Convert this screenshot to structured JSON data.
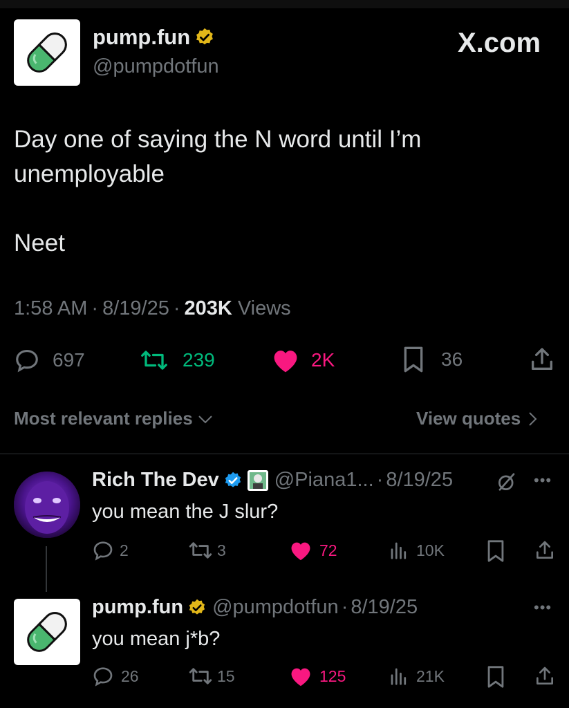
{
  "header": {
    "display_name": "pump.fun",
    "handle": "@pumpdotfun",
    "site_label": "X.com"
  },
  "post": {
    "text_line1": "Day one of saying the N word until I’m",
    "text_line2": "unemployable",
    "text_line3": "Neet",
    "time": "1:58 AM",
    "date": "8/19/25",
    "views_count": "203K",
    "views_label": "Views",
    "replies": "697",
    "reposts": "239",
    "likes": "2K",
    "bookmarks": "36"
  },
  "replies_bar": {
    "sort_label": "Most relevant replies",
    "quotes_label": "View quotes"
  },
  "reply1": {
    "name": "Rich The Dev",
    "handle": "@Piana1...",
    "date": "8/19/25",
    "text": "you mean the J slur?",
    "replies": "2",
    "reposts": "3",
    "likes": "72",
    "views": "10K"
  },
  "reply2": {
    "name": "pump.fun",
    "handle": "@pumpdotfun",
    "date": "8/19/25",
    "text": "you mean j*b?",
    "replies": "26",
    "reposts": "15",
    "likes": "125",
    "views": "21K"
  },
  "colors": {
    "background": "#000000",
    "text": "#e7e9ea",
    "muted": "#71767b",
    "repost_green": "#00ba7c",
    "like_pink": "#f91880",
    "verified_gold": "#e2b719",
    "verified_blue": "#1d9bf0"
  }
}
